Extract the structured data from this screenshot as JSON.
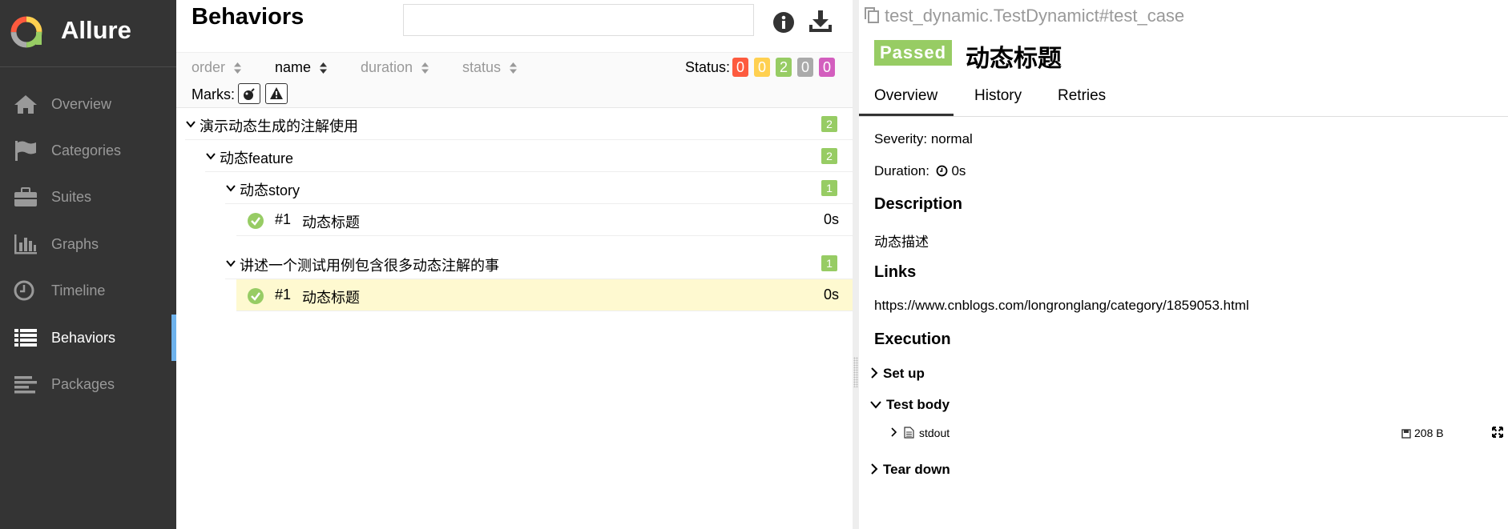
{
  "app": {
    "name": "Allure"
  },
  "colors": {
    "sidebar_bg": "#343434",
    "accent": "#6eb2ec",
    "passed": "#97cc64",
    "failed": "#fd5a3e",
    "broken": "#ffd050",
    "skipped": "#aaaaaa",
    "unknown": "#d35ebe",
    "selected_row": "#fef9d0"
  },
  "sidebar": {
    "items": [
      {
        "label": "Overview",
        "icon": "home-icon"
      },
      {
        "label": "Categories",
        "icon": "flag-icon"
      },
      {
        "label": "Suites",
        "icon": "briefcase-icon"
      },
      {
        "label": "Graphs",
        "icon": "bar-chart-icon"
      },
      {
        "label": "Timeline",
        "icon": "clock-icon"
      },
      {
        "label": "Behaviors",
        "icon": "list-icon",
        "active": true
      },
      {
        "label": "Packages",
        "icon": "align-left-icon"
      }
    ]
  },
  "behaviors": {
    "title": "Behaviors",
    "search": {
      "value": "",
      "placeholder": ""
    },
    "sort": {
      "order": "order",
      "name": "name",
      "duration": "duration",
      "status": "status",
      "active": "name"
    },
    "status_label": "Status:",
    "status_counts": {
      "failed": "0",
      "broken": "0",
      "passed": "2",
      "skipped": "0",
      "unknown": "0"
    },
    "marks_label": "Marks:",
    "marks": [
      "bomb-icon",
      "warning-icon"
    ],
    "tree": {
      "epic": {
        "label": "演示动态生成的注解使用",
        "count": "2"
      },
      "feature": {
        "label": "动态feature",
        "count": "2"
      },
      "story1": {
        "label": "动态story",
        "count": "1"
      },
      "test1": {
        "num": "#1",
        "name": "动态标题",
        "duration": "0s"
      },
      "story2": {
        "label": "讲述一个测试用例包含很多动态注解的事",
        "count": "1"
      },
      "test2": {
        "num": "#1",
        "name": "动态标题",
        "duration": "0s",
        "selected": true
      }
    }
  },
  "detail": {
    "test_id": "test_dynamic.TestDynamict#test_case",
    "status": "Passed",
    "title": "动态标题",
    "tabs": [
      "Overview",
      "History",
      "Retries"
    ],
    "severity": "Severity: normal",
    "duration_label": "Duration:",
    "duration_value": "0s",
    "description_heading": "Description",
    "description": "动态描述",
    "links_heading": "Links",
    "link": "https://www.cnblogs.com/longronglang/category/1859053.html",
    "execution_heading": "Execution",
    "setup": "Set up",
    "body": "Test body",
    "attachment": {
      "name": "stdout",
      "size": "208 B"
    },
    "teardown": "Tear down"
  }
}
